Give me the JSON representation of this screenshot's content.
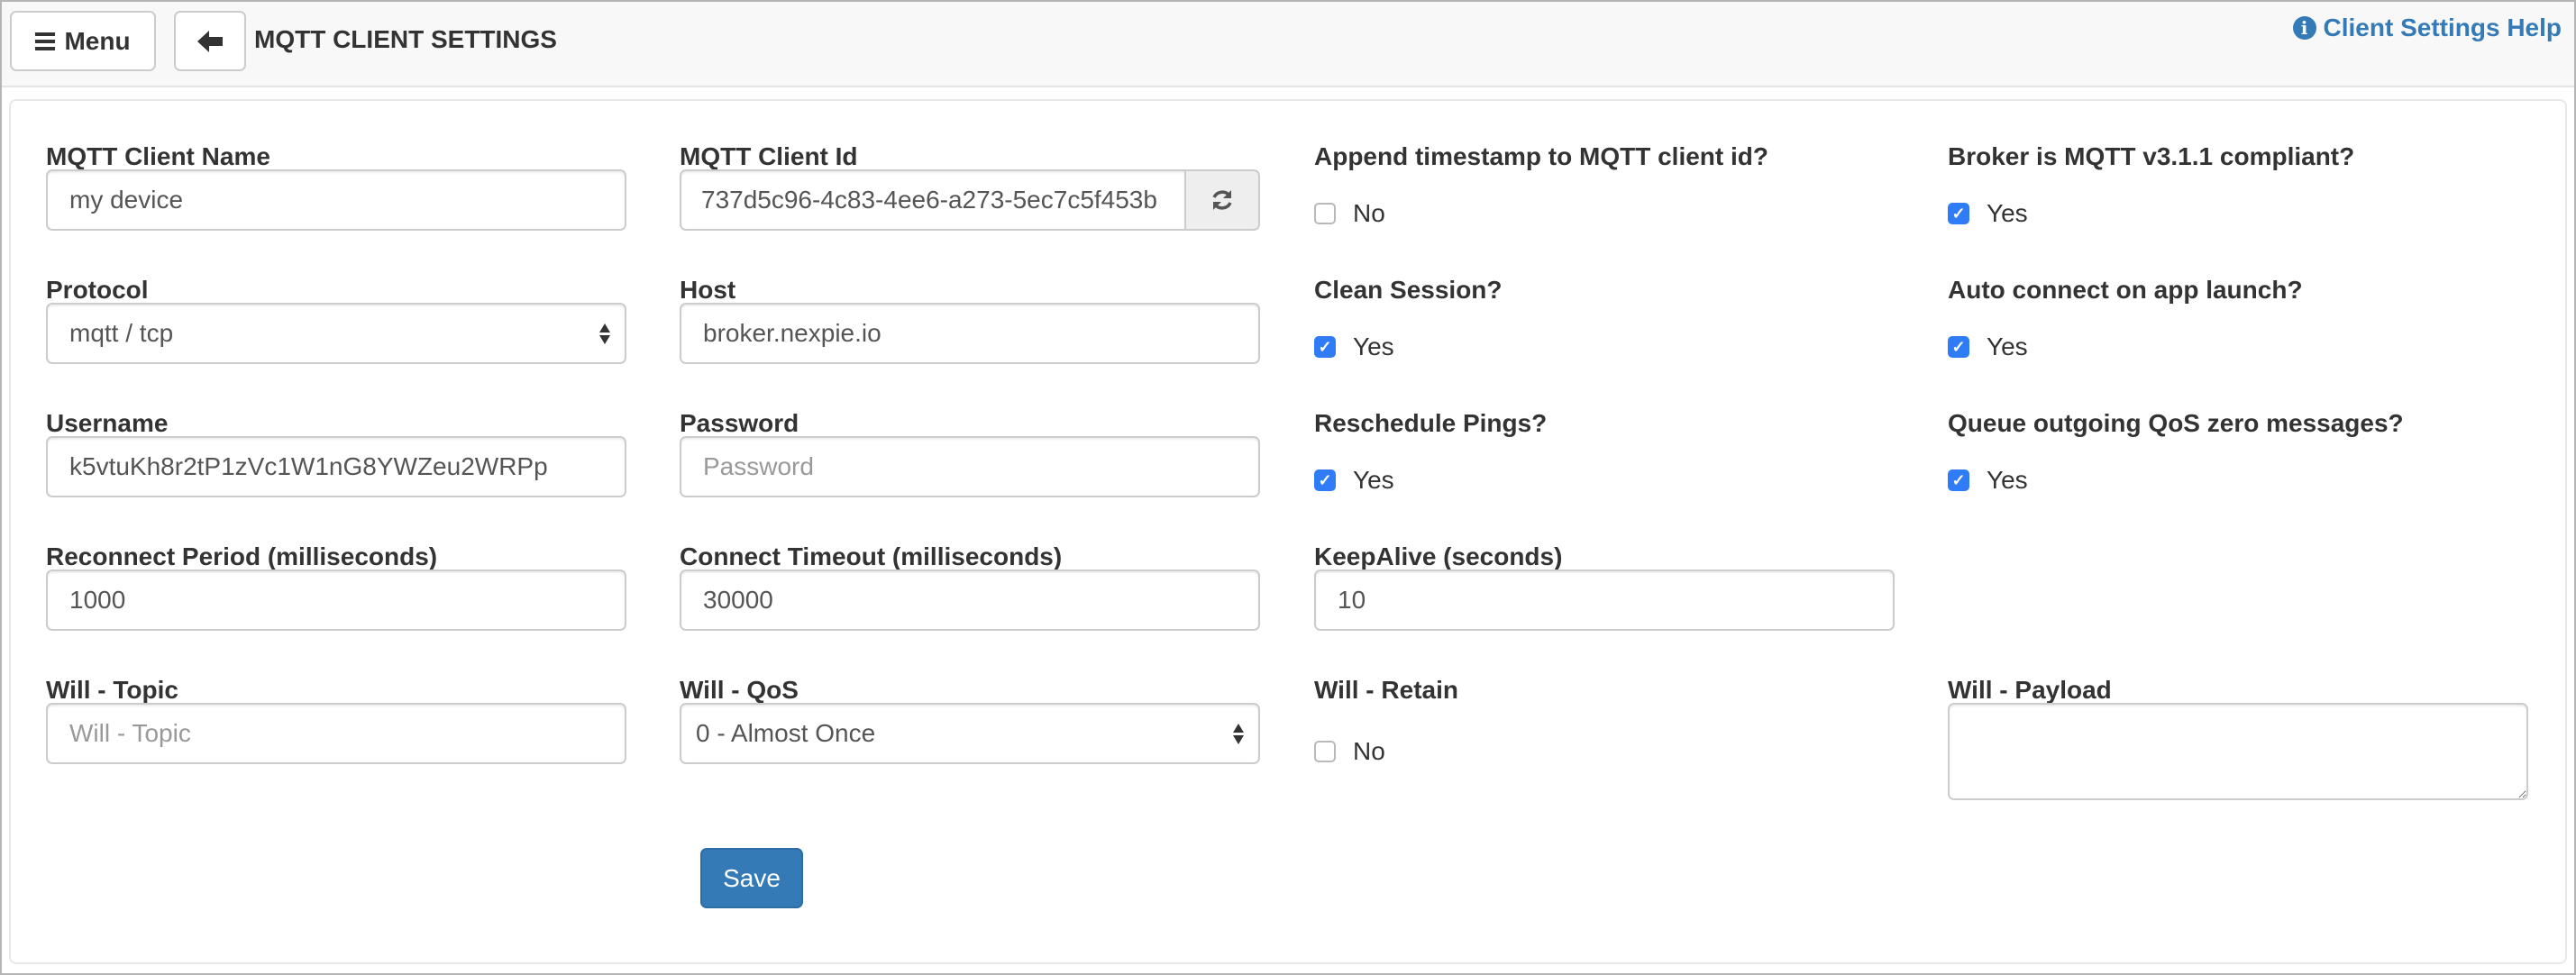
{
  "header": {
    "menu_label": "Menu",
    "back_icon": "arrow-left-icon",
    "title": "MQTT CLIENT SETTINGS",
    "help_label": "Client Settings Help",
    "help_icon": "info-circle-icon",
    "accent_color": "#337ab7"
  },
  "form": {
    "client_name": {
      "label": "MQTT Client Name",
      "value": "my device"
    },
    "client_id": {
      "label": "MQTT Client Id",
      "value": "737d5c96-4c83-4ee6-a273-5ec7c5f453b",
      "refresh_icon": "refresh-icon"
    },
    "append_timestamp": {
      "label": "Append timestamp to MQTT client id?",
      "checked": false,
      "state_label": "No"
    },
    "broker_compliant": {
      "label": "Broker is MQTT v3.1.1 compliant?",
      "checked": true,
      "state_label": "Yes"
    },
    "protocol": {
      "label": "Protocol",
      "value": "mqtt / tcp"
    },
    "host": {
      "label": "Host",
      "value": "broker.nexpie.io"
    },
    "clean_session": {
      "label": "Clean Session?",
      "checked": true,
      "state_label": "Yes"
    },
    "auto_connect": {
      "label": "Auto connect on app launch?",
      "checked": true,
      "state_label": "Yes"
    },
    "username": {
      "label": "Username",
      "value": "k5vtuKh8r2tP1zVc1W1nG8YWZeu2WRPp"
    },
    "password": {
      "label": "Password",
      "value": "",
      "placeholder": "Password"
    },
    "reschedule_pings": {
      "label": "Reschedule Pings?",
      "checked": true,
      "state_label": "Yes"
    },
    "queue_qos_zero": {
      "label": "Queue outgoing QoS zero messages?",
      "checked": true,
      "state_label": "Yes"
    },
    "reconnect_period": {
      "label": "Reconnect Period (milliseconds)",
      "value": "1000"
    },
    "connect_timeout": {
      "label": "Connect Timeout (milliseconds)",
      "value": "30000"
    },
    "keepalive": {
      "label": "KeepAlive (seconds)",
      "value": "10"
    },
    "will_topic": {
      "label": "Will - Topic",
      "value": "",
      "placeholder": "Will - Topic"
    },
    "will_qos": {
      "label": "Will - QoS",
      "value": "0 - Almost Once"
    },
    "will_retain": {
      "label": "Will - Retain",
      "checked": false,
      "state_label": "No"
    },
    "will_payload": {
      "label": "Will - Payload",
      "value": ""
    },
    "save_label": "Save",
    "checkbox_color": "#2f7cf6"
  }
}
